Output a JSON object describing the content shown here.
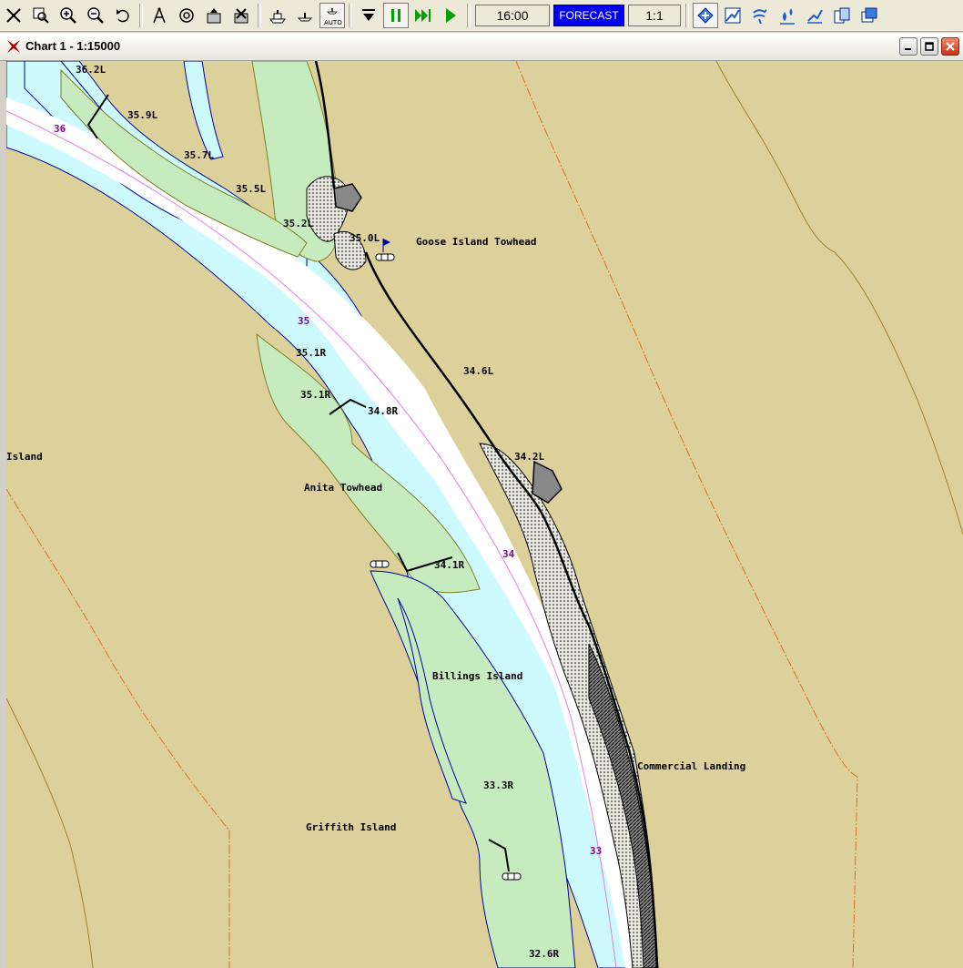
{
  "toolbar": {
    "time": "16:00",
    "forecast_label": "FORECAST",
    "scale": "1:1",
    "auto_label": "AUTO",
    "icons": [
      "fit-chart-icon",
      "zoom-window-icon",
      "zoom-in-icon",
      "zoom-out-icon",
      "undo-icon",
      "compass-icon",
      "target-icon",
      "export-icon",
      "vessel-settings-icon",
      "ship-icon",
      "ship-small-icon",
      "auto-follow-icon",
      "download-icon",
      "pause-icon",
      "fast-forward-icon",
      "play-icon",
      "chart-layers-icon",
      "chart-edit-icon",
      "weather-icon",
      "water-icon",
      "route-icon",
      "copy-icon",
      "window-icon"
    ]
  },
  "window": {
    "title": "Chart 1 - 1:15000"
  },
  "map": {
    "place_labels": {
      "goose_island_towhead": "Goose Island Towhead",
      "island": "Island",
      "anita_towhead": "Anita Towhead",
      "billings_island": "Billings Island",
      "commercial_landing": "Commercial Landing",
      "griffith_island": "Griffith Island"
    },
    "mile_markers": {
      "m36": "36",
      "m35": "35",
      "m34": "34",
      "m33": "33"
    },
    "light_labels": {
      "l362L": "36.2L",
      "l359L": "35.9L",
      "l357L": "35.7L",
      "l355L": "35.5L",
      "l352L": "35.2L",
      "l350L": "35.0L",
      "l351R_a": "35.1R",
      "l351R_b": "35.1R",
      "l348R": "34.8R",
      "l346L": "34.6L",
      "l342L": "34.2L",
      "l341R": "34.1R",
      "l333R": "33.3R",
      "l326R": "32.6R"
    },
    "colors": {
      "land": "#ddd19b",
      "shallow_water": "#ccfaff",
      "channel": "#ffffff",
      "island": "#c6ebbf",
      "magenta": "#8b008b"
    }
  }
}
